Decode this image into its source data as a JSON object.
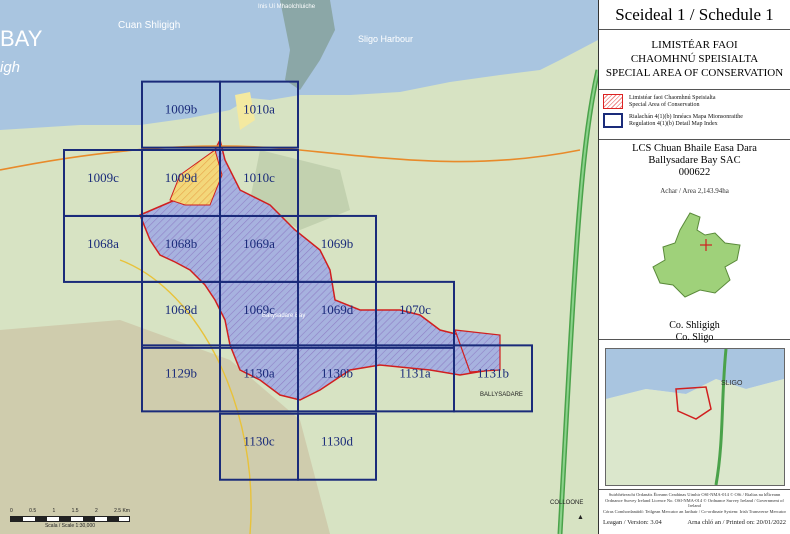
{
  "map": {
    "bay_left": "BAY",
    "bay_left_sub": "igh",
    "cuan_shligigh": "Cuan Shligigh",
    "sligo_harbour": "Sligo Harbour",
    "inis_ui_mhaolchluiche": "Inis Uí Mhaolchluiche",
    "ballysadare_town": "BALLYSADARE",
    "collooney": "COLLOONE",
    "ballysadare_bay": "Ballysadare Bay",
    "tiles": [
      {
        "id": "1009b"
      },
      {
        "id": "1010a"
      },
      {
        "id": "1009c"
      },
      {
        "id": "1009d"
      },
      {
        "id": "1010c"
      },
      {
        "id": "1068a"
      },
      {
        "id": "1068b"
      },
      {
        "id": "1069a"
      },
      {
        "id": "1069b"
      },
      {
        "id": "1068d"
      },
      {
        "id": "1069c"
      },
      {
        "id": "1069d"
      },
      {
        "id": "1070c"
      },
      {
        "id": "1129b"
      },
      {
        "id": "1130a"
      },
      {
        "id": "1130b"
      },
      {
        "id": "1131a"
      },
      {
        "id": "1131b"
      },
      {
        "id": "1130c"
      },
      {
        "id": "1130d"
      }
    ],
    "scale_ticks": [
      "0",
      "0.5",
      "1",
      "1.5",
      "2",
      "2.5 Km"
    ],
    "scale_label": "Scala / Scale 1:30,000",
    "colors": {
      "grid": "#1a2b7a",
      "sac_border": "#d11f1f",
      "water": "#a9c5e0",
      "land": "#d7e3c3"
    }
  },
  "panel": {
    "title": "Sceideal 1 / Schedule 1",
    "subtitle_lines": [
      "LIMISTÉAR FAOI",
      "CHAOMHNÚ SPEISIALTA",
      "SPECIAL AREA OF CONSERVATION"
    ],
    "legend": [
      {
        "text": "Limistéar faoi Chaomhnú Speisialta\nSpecial Area of Conservation"
      },
      {
        "text": "Rialachán 4(1)(b) Innéacs Mapa Mionsonraithe\nRegulation 4(1)(b) Detail Map Index"
      }
    ],
    "site_irish": "LCS Chuan Bhaile Easa Dara",
    "site_english": "Ballysadare Bay SAC",
    "site_code": "000622",
    "area": "Achar / Area 2,143.94ha",
    "county_irish": "Co. Shligigh",
    "county_english": "Co. Sligo",
    "inset_label": "SLIGO",
    "footer_lines": [
      "Suirbhéireacht Ordanáis Éireann Ceadúnas Uimhir OSI-NMA-014 © OSi / Rialtas na hÉireann",
      "Ordnance Survey Ireland Licence No. OSI-NMA-014 © Ordnance Survey Ireland / Government of Ireland",
      "Córas Comhordanáidí: Teilgean Mercator an Iarthair / Co-ordinate System: Irish Transverse Mercator"
    ],
    "version": "Leagan / Version: 3.04",
    "printed": "Arna chló an / Printed on: 20/01/2022"
  }
}
